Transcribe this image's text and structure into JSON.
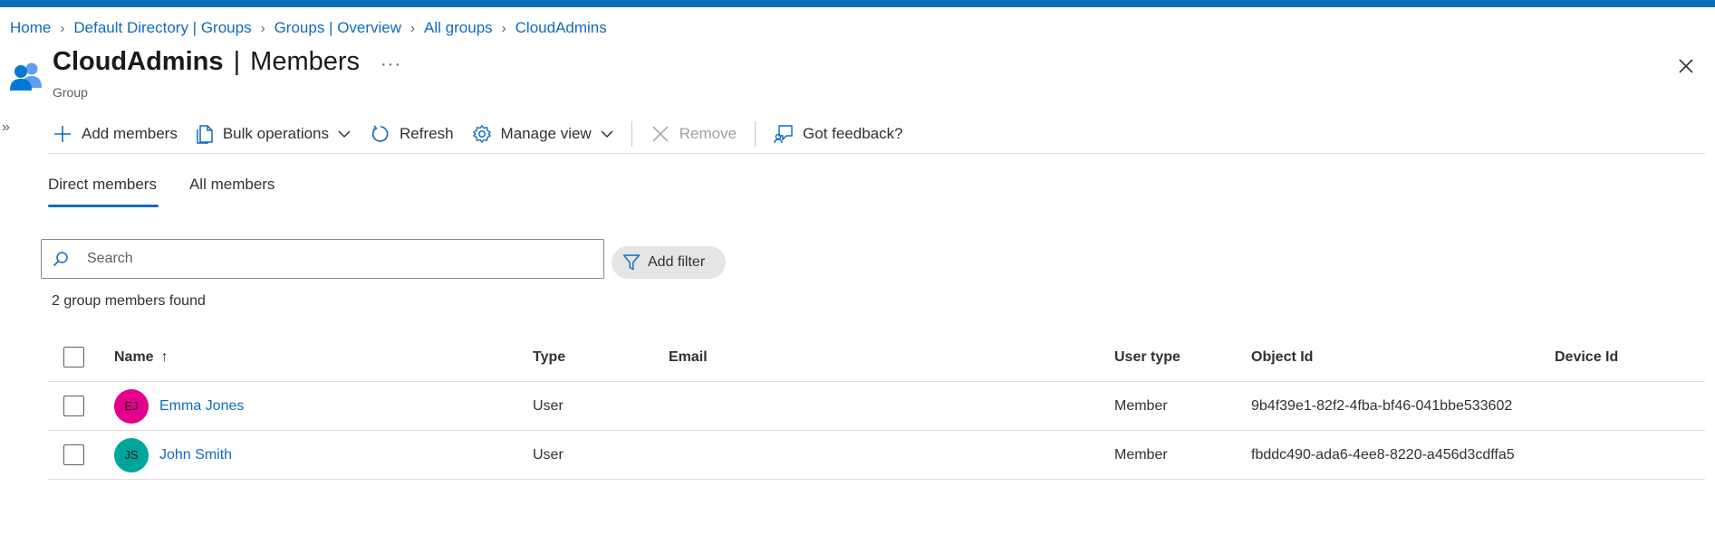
{
  "breadcrumb": {
    "items": [
      "Home",
      "Default Directory | Groups",
      "Groups | Overview",
      "All groups",
      "CloudAdmins"
    ]
  },
  "header": {
    "title_name": "CloudAdmins",
    "title_separator": "|",
    "title_section": "Members",
    "more_label": "···",
    "subtitle": "Group"
  },
  "toolbar": {
    "add_members": "Add members",
    "bulk_operations": "Bulk operations",
    "refresh": "Refresh",
    "manage_view": "Manage view",
    "remove": "Remove",
    "feedback": "Got feedback?"
  },
  "tabs": [
    {
      "label": "Direct members",
      "active": true
    },
    {
      "label": "All members",
      "active": false
    }
  ],
  "search": {
    "placeholder": "Search"
  },
  "filter": {
    "label": "Add filter"
  },
  "count_text": "2 group members found",
  "table": {
    "columns": [
      "Name",
      "Type",
      "Email",
      "User type",
      "Object Id",
      "Device Id"
    ],
    "sort_indicator": "↑",
    "rows": [
      {
        "initials": "EJ",
        "avatar_color": "#e3008c",
        "name": "Emma Jones",
        "type": "User",
        "email": "",
        "user_type": "Member",
        "object_id": "9b4f39e1-82f2-4fba-bf46-041bbe533602",
        "device_id": ""
      },
      {
        "initials": "JS",
        "avatar_color": "#00a59b",
        "name": "John Smith",
        "type": "User",
        "email": "",
        "user_type": "Member",
        "object_id": "fbddc490-ada6-4ee8-8220-a456d3cdffa5",
        "device_id": ""
      }
    ]
  },
  "colors": {
    "accent": "#0f6cbd",
    "divider": "#e1dfdd",
    "disabled": "#a19f9d"
  }
}
